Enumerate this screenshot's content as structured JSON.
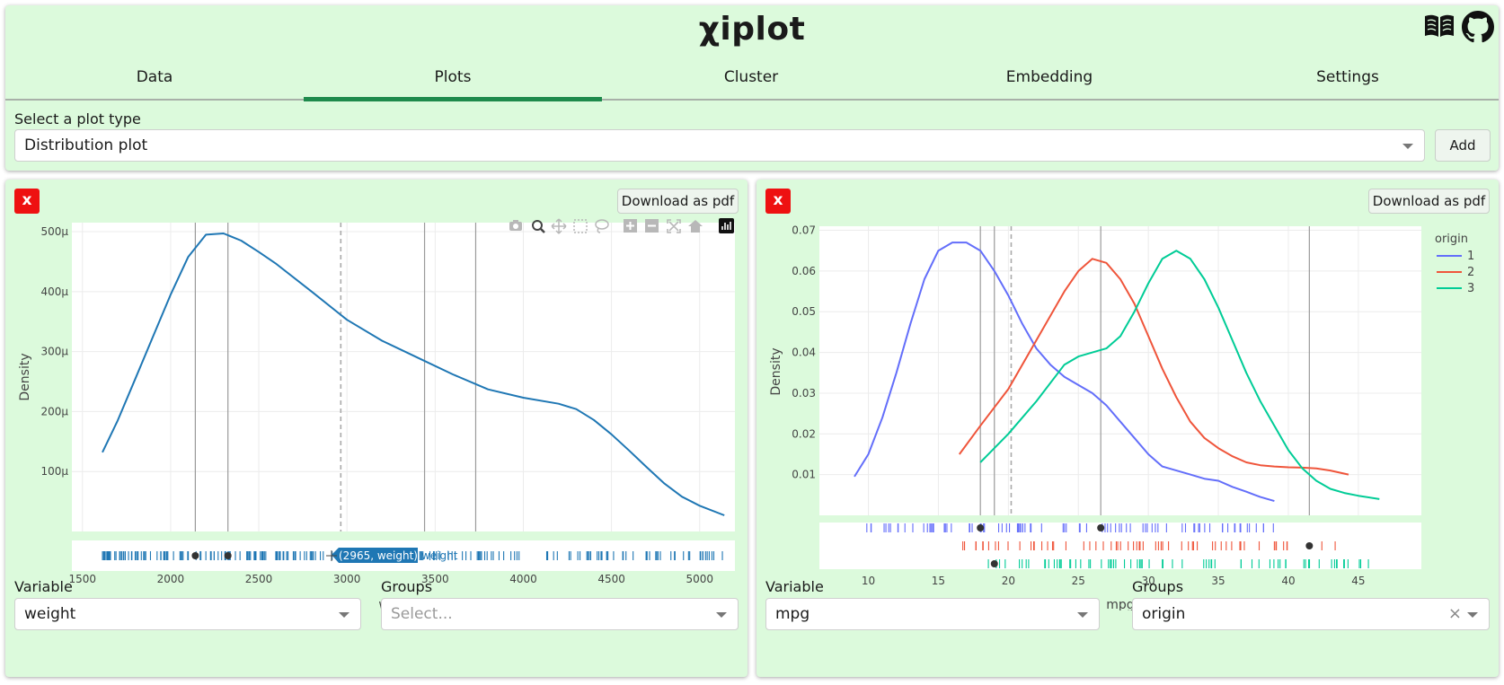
{
  "app": {
    "title": "χiplot",
    "accent_color": "#1e8a4c",
    "background_color": "#dcfadc"
  },
  "header": {
    "icons": [
      "book-icon",
      "github-icon"
    ]
  },
  "tabs": [
    {
      "label": "Data",
      "active": false
    },
    {
      "label": "Plots",
      "active": true
    },
    {
      "label": "Cluster",
      "active": false
    },
    {
      "label": "Embedding",
      "active": false
    },
    {
      "label": "Settings",
      "active": false
    }
  ],
  "plot_selector": {
    "label": "Select a plot type",
    "value": "Distribution plot",
    "add_label": "Add"
  },
  "plots": [
    {
      "close_label": "x",
      "download_label": "Download as pdf",
      "variable_label": "Variable",
      "variable_value": "weight",
      "groups_label": "Groups",
      "groups_placeholder": "Select...",
      "hover_label": "(2965, weight)",
      "hover_trace": "weight",
      "modebar_icons": [
        "camera-icon",
        "zoom-icon",
        "pan-icon",
        "box-select-icon",
        "lasso-icon",
        "zoom-in-icon",
        "zoom-out-icon",
        "autoscale-icon",
        "reset-axes-icon",
        "plotly-logo-icon"
      ]
    },
    {
      "close_label": "x",
      "download_label": "Download as pdf",
      "variable_label": "Variable",
      "variable_value": "mpg",
      "groups_label": "Groups",
      "groups_value": "origin",
      "clear_label": "×"
    }
  ],
  "chart_data": [
    {
      "type": "line",
      "title": "",
      "xlabel": "weight",
      "ylabel": "Density",
      "xlim": [
        1440,
        5200
      ],
      "ylim": [
        0,
        0.000515
      ],
      "xticks": [
        1500,
        2000,
        2500,
        3000,
        3500,
        4000,
        4500,
        5000
      ],
      "yticks": [
        0.0001,
        0.0002,
        0.0003,
        0.0004,
        0.0005
      ],
      "ytick_labels": [
        "100μ",
        "200μ",
        "300μ",
        "400μ",
        "500μ"
      ],
      "series": [
        {
          "color": "#1f77b4",
          "x": [
            1613,
            1700,
            1800,
            1900,
            2000,
            2100,
            2200,
            2300,
            2400,
            2500,
            2600,
            2800,
            3000,
            3200,
            3400,
            3600,
            3800,
            4000,
            4200,
            4300,
            4400,
            4500,
            4600,
            4700,
            4800,
            4900,
            5000,
            5140
          ],
          "y": [
            0.000132,
            0.000185,
            0.000255,
            0.000325,
            0.000395,
            0.000458,
            0.000495,
            0.000497,
            0.000485,
            0.000466,
            0.000446,
            0.0004,
            0.000353,
            0.000318,
            0.00029,
            0.000262,
            0.000237,
            0.000223,
            0.000213,
            0.000204,
            0.000186,
            0.000162,
            0.000135,
            0.000107,
            8e-05,
            5.8e-05,
            4.3e-05,
            2.7e-05
          ]
        }
      ],
      "vlines": {
        "solid": [
          2140,
          2325,
          3440,
          3730
        ],
        "dashed": [
          2965
        ]
      },
      "rug_markers": [
        2140,
        2325
      ]
    },
    {
      "type": "line",
      "title": "",
      "xlabel": "mpg",
      "ylabel": "Density",
      "xlim": [
        6.5,
        49.5
      ],
      "ylim": [
        0,
        0.071
      ],
      "xticks": [
        10,
        15,
        20,
        25,
        30,
        35,
        40,
        45
      ],
      "yticks": [
        0.01,
        0.02,
        0.03,
        0.04,
        0.05,
        0.06,
        0.07
      ],
      "legend": {
        "title": "origin",
        "position": "top-right"
      },
      "series": [
        {
          "name": "1",
          "color": "#636efa",
          "x": [
            9,
            10,
            11,
            12,
            13,
            14,
            15,
            16,
            17,
            18,
            19,
            20,
            21,
            22,
            23,
            24,
            25,
            26,
            27,
            28,
            29,
            30,
            31,
            32,
            33,
            34,
            35,
            36,
            37,
            38,
            39
          ],
          "y": [
            0.0095,
            0.015,
            0.024,
            0.035,
            0.047,
            0.058,
            0.065,
            0.067,
            0.067,
            0.065,
            0.06,
            0.054,
            0.047,
            0.041,
            0.037,
            0.034,
            0.032,
            0.03,
            0.027,
            0.023,
            0.019,
            0.015,
            0.012,
            0.011,
            0.01,
            0.009,
            0.0085,
            0.007,
            0.0058,
            0.0045,
            0.0035
          ]
        },
        {
          "name": "2",
          "color": "#ef553b",
          "x": [
            16.5,
            18,
            20,
            22,
            24,
            25,
            26,
            27,
            28,
            29,
            30,
            31,
            32,
            33,
            34,
            35,
            36,
            37,
            38,
            39,
            40,
            41,
            42,
            43,
            44.3
          ],
          "y": [
            0.015,
            0.022,
            0.031,
            0.043,
            0.055,
            0.06,
            0.063,
            0.062,
            0.058,
            0.052,
            0.044,
            0.036,
            0.029,
            0.023,
            0.019,
            0.0165,
            0.0145,
            0.013,
            0.0123,
            0.012,
            0.0118,
            0.0117,
            0.0115,
            0.011,
            0.01
          ]
        },
        {
          "name": "3",
          "color": "#00cc96",
          "x": [
            18,
            20,
            22,
            24,
            25,
            26,
            27,
            28,
            29,
            30,
            31,
            32,
            33,
            34,
            35,
            36,
            37,
            38,
            39,
            40,
            41,
            42,
            43,
            44,
            45,
            46.5
          ],
          "y": [
            0.013,
            0.02,
            0.028,
            0.037,
            0.039,
            0.04,
            0.041,
            0.044,
            0.05,
            0.057,
            0.063,
            0.065,
            0.063,
            0.058,
            0.051,
            0.043,
            0.035,
            0.028,
            0.022,
            0.016,
            0.0115,
            0.0085,
            0.0065,
            0.0055,
            0.0048,
            0.004
          ]
        }
      ],
      "vlines": {
        "solid": [
          18,
          19,
          26.6,
          41.5
        ],
        "dashed": [
          20.2
        ]
      },
      "rug_markers": [
        {
          "group": "3",
          "x": 19
        },
        {
          "group": "2",
          "x": 41.5
        },
        {
          "group": "1",
          "x": 18
        },
        {
          "group": "1",
          "x": 26.6
        }
      ]
    }
  ]
}
